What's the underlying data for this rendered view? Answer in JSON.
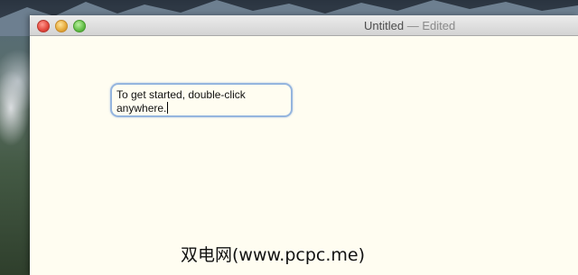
{
  "window": {
    "title": "Untitled",
    "status": "— Edited"
  },
  "document": {
    "text": "To get started, double-click anywhere."
  },
  "watermark": {
    "text": "双电网(www.pcpc.me)"
  }
}
